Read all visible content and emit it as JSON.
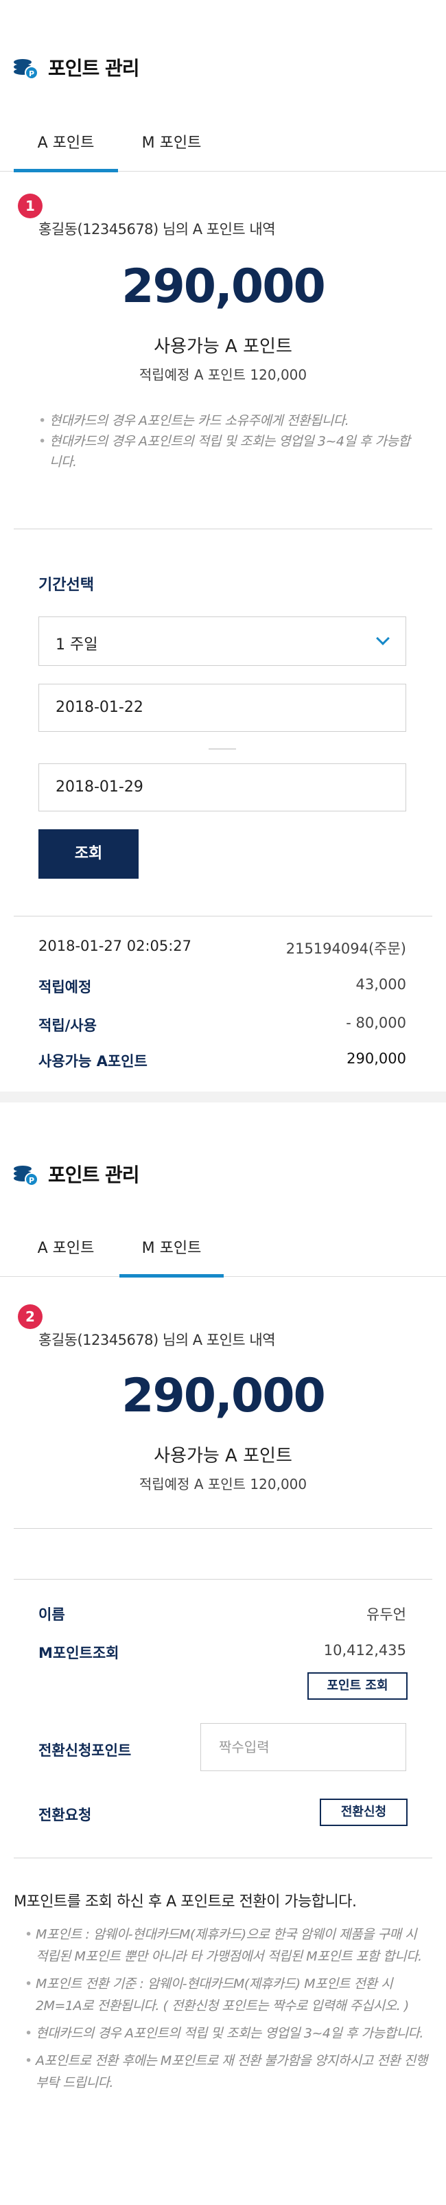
{
  "header": {
    "title": "포인트 관리",
    "badge_letter": "P"
  },
  "tabs": [
    {
      "label": "A 포인트"
    },
    {
      "label": "M 포인트"
    }
  ],
  "panel_a": {
    "step": "1",
    "owner_line": "홍길동(12345678) 님의 A 포인트 내역",
    "points": "290,000",
    "available_label": "사용가능 A 포인트",
    "pending_line": "적립예정 A 포인트 120,000",
    "notes": [
      "현대카드의 경우 A포인트는 카드 소유주에게 전환됩니다.",
      "현대카드의 경우 A포인트의 적립 및 조회는 영업일 3~4일 후 가능합니다."
    ],
    "period": {
      "title": "기간선택",
      "selected": "1 주일",
      "from": "2018-01-22",
      "to": "2018-01-29",
      "search_button": "조회"
    },
    "history": {
      "datetime": "2018-01-27 02:05:27",
      "order": "215194094(주문)",
      "rows": [
        {
          "label": "적립예정",
          "value": "43,000"
        },
        {
          "label": "적립/사용",
          "value": "- 80,000"
        },
        {
          "label": "사용가능 A포인트",
          "value": "290,000"
        }
      ]
    }
  },
  "panel_m": {
    "step": "2",
    "owner_line": "홍길동(12345678) 님의 A 포인트 내역",
    "points": "290,000",
    "available_label": "사용가능 A 포인트",
    "pending_line": "적립예정 A 포인트 120,000",
    "table": {
      "name_label": "이름",
      "name_value": "유두언",
      "inquiry_label": "M포인트조회",
      "inquiry_value": "10,412,435",
      "inquiry_button": "포인트 조회",
      "conv_label": "전환신청포인트",
      "conv_placeholder": "짝수입력",
      "request_label": "전환요청",
      "request_button": "전환신청"
    },
    "message": "M포인트를 조회 하신 후 A 포인트로 전환이 가능합니다.",
    "notes": [
      "M포인트 : 암웨이-현대카드M(제휴카드)으로 한국 암웨이 제품을 구매 시 적립된 M포인트 뿐만 아니라 타 가맹점에서 적립된 M포인트 포함 합니다.",
      "M포인트 전환 기준 : 암웨이-현대카드M(제휴카드) M포인트 전환 시 2M=1A로 전환됩니다. ( 전환신청 포인트는 짝수로 입력해 주십시오. )",
      "현대카드의 경우 A포인트의 적립 및 조회는 영업일 3~4일 후 가능합니다.",
      "A포인트로 전환 후에는 M포인트로 재 전환 불가함을 양지하시고 전환 진행 부탁 드립니다."
    ]
  },
  "colors": {
    "navy": "#0f2a55",
    "accent": "#1689c9",
    "badge": "#e02a4e"
  }
}
